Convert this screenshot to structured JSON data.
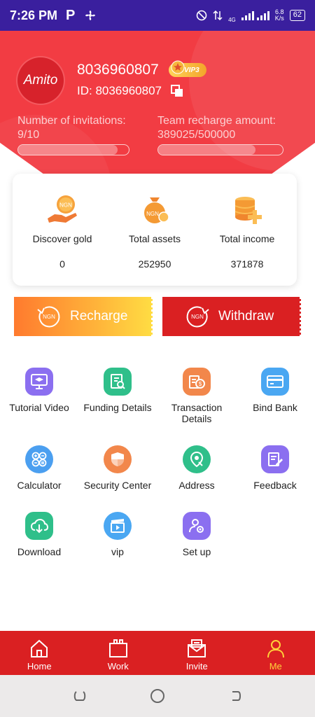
{
  "status_bar": {
    "time": "7:26 PM",
    "p_label": "P",
    "net_type": "4G",
    "speed_value": "6.8",
    "speed_unit": "K/s",
    "battery": "62"
  },
  "profile": {
    "avatar_text": "Amito",
    "phone": "8036960807",
    "vip": "VIP3",
    "id_label": "ID: 8036960807"
  },
  "invitations": {
    "label": "Number of invitations:",
    "value": "9/10",
    "progress": 0.9
  },
  "team_recharge": {
    "label": "Team recharge amount:",
    "value": "389025/500000",
    "progress": 0.78
  },
  "assets": [
    {
      "label": "Discover gold",
      "value": "0",
      "icon": "hand-coin-icon"
    },
    {
      "label": "Total assets",
      "value": "252950",
      "icon": "money-bag-icon"
    },
    {
      "label": "Total income",
      "value": "371878",
      "icon": "coin-stack-icon"
    }
  ],
  "actions": {
    "recharge": "Recharge",
    "withdraw": "Withdraw",
    "ngn": "NGN"
  },
  "menu": [
    {
      "label": "Tutorial Video",
      "icon": "monitor-cap-icon",
      "color": "#8b6ff0"
    },
    {
      "label": "Funding Details",
      "icon": "document-search-icon",
      "color": "#2fbf8a"
    },
    {
      "label": "Transaction Details",
      "icon": "coins-document-icon",
      "color": "#f2874b"
    },
    {
      "label": "Bind Bank",
      "icon": "card-icon",
      "color": "#4aa7f2"
    },
    {
      "label": "Calculator",
      "icon": "calculator-icon",
      "color": "#4b9ff0"
    },
    {
      "label": "Security Center",
      "icon": "shield-icon",
      "color": "#f2874b"
    },
    {
      "label": "Address",
      "icon": "location-icon",
      "color": "#2fbf8a"
    },
    {
      "label": "Feedback",
      "icon": "edit-document-icon",
      "color": "#8b6ff0"
    },
    {
      "label": "Download",
      "icon": "cloud-download-icon",
      "color": "#2fbf8a"
    },
    {
      "label": "vip",
      "icon": "video-icon",
      "color": "#4aa7f2"
    },
    {
      "label": "Set up",
      "icon": "settings-user-icon",
      "color": "#8b6ff0"
    }
  ],
  "bottom_nav": [
    {
      "label": "Home",
      "icon": "home-icon"
    },
    {
      "label": "Work",
      "icon": "work-icon"
    },
    {
      "label": "Invite",
      "icon": "mail-icon"
    },
    {
      "label": "Me",
      "icon": "user-icon",
      "active": true
    }
  ],
  "colors": {
    "brand_red": "#f23c43",
    "nav_red": "#da2022",
    "active_yellow": "#ffd23a",
    "status_purple": "#3a1f9e"
  }
}
